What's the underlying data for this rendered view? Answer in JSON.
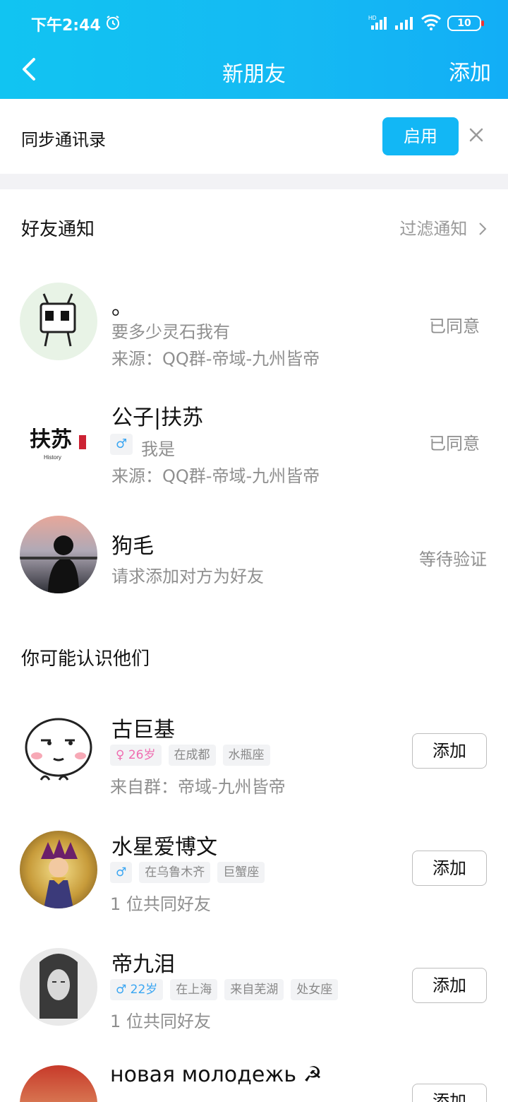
{
  "status_bar": {
    "time": "下午2:44",
    "battery": "10",
    "icons": [
      "alarm-icon",
      "signal-hd-icon",
      "signal-icon",
      "wifi-icon",
      "battery-icon"
    ]
  },
  "nav": {
    "title": "新朋友",
    "add_label": "添加",
    "back_icon": "chevron-left-icon"
  },
  "sync": {
    "label": "同步通讯录",
    "enable_label": "启用",
    "close_icon": "close-icon"
  },
  "friend_notices": {
    "title": "好友通知",
    "filter_label": "过滤通知",
    "items": [
      {
        "name": "。",
        "message": "要多少灵石我有",
        "source": "来源：QQ群-帝域-九州皆帝",
        "status": "已同意"
      },
      {
        "name": "公子|扶苏",
        "gender": "♂",
        "message": "我是",
        "source": "来源：QQ群-帝域-九州皆帝",
        "status": "已同意"
      },
      {
        "name": "狗毛",
        "message": "请求添加对方为好友",
        "status": "等待验证"
      }
    ]
  },
  "suggestions": {
    "title": "你可能认识他们",
    "items": [
      {
        "name": "古巨基",
        "tags": [
          "♀ 26岁",
          "在成都",
          "水瓶座"
        ],
        "detail": "来自群：帝域-九州皆帝",
        "add_label": "添加"
      },
      {
        "name": "水星爱博文",
        "tags": [
          "♂",
          "在乌鲁木齐",
          "巨蟹座"
        ],
        "detail": "1 位共同好友",
        "add_label": "添加"
      },
      {
        "name": "帝九泪",
        "tags": [
          "♂ 22岁",
          "在上海",
          "来自芜湖",
          "处女座"
        ],
        "detail": "1 位共同好友",
        "add_label": "添加"
      },
      {
        "name": "новая молодежь ☭",
        "add_label": "添加"
      }
    ]
  },
  "colors": {
    "header": "#12b7f5",
    "enable_button": "#12b7f5",
    "male": "#3aa6f2",
    "female": "#f06cb0"
  }
}
